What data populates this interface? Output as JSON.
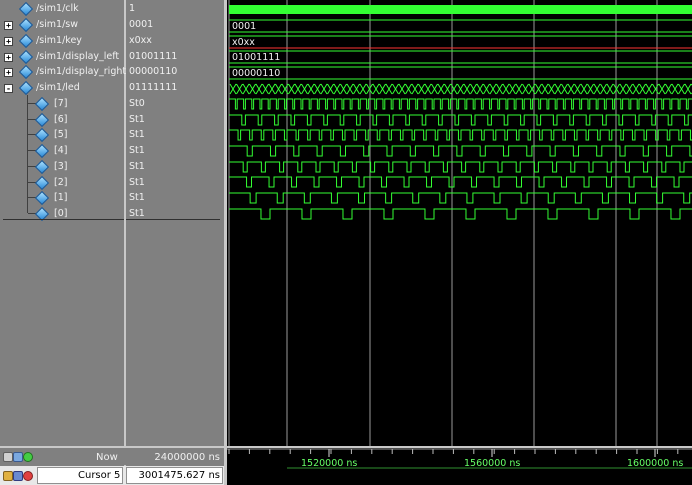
{
  "signals": [
    {
      "name": "/sim1/clk",
      "value": "1",
      "expander": "",
      "level": 0
    },
    {
      "name": "/sim1/sw",
      "value": "0001",
      "expander": "+",
      "level": 0
    },
    {
      "name": "/sim1/key",
      "value": "x0xx",
      "expander": "+",
      "level": 0
    },
    {
      "name": "/sim1/display_left",
      "value": "01001111",
      "expander": "+",
      "level": 0
    },
    {
      "name": "/sim1/display_right",
      "value": "00000110",
      "expander": "+",
      "level": 0
    },
    {
      "name": "/sim1/led",
      "value": "01111111",
      "expander": "-",
      "level": 0
    },
    {
      "name": "[7]",
      "value": "St0",
      "expander": "",
      "level": 1
    },
    {
      "name": "[6]",
      "value": "St1",
      "expander": "",
      "level": 1
    },
    {
      "name": "[5]",
      "value": "St1",
      "expander": "",
      "level": 1
    },
    {
      "name": "[4]",
      "value": "St1",
      "expander": "",
      "level": 1
    },
    {
      "name": "[3]",
      "value": "St1",
      "expander": "",
      "level": 1
    },
    {
      "name": "[2]",
      "value": "St1",
      "expander": "",
      "level": 1
    },
    {
      "name": "[1]",
      "value": "St1",
      "expander": "",
      "level": 1
    },
    {
      "name": "[0]",
      "value": "St1",
      "expander": "",
      "level": 1
    }
  ],
  "waves": {
    "sw_bus": "0001",
    "key_bus": "x0xx",
    "display_left_bus": "01001111",
    "display_right_bus": "00000110"
  },
  "status": {
    "now_label": "Now",
    "now_value": "24000000 ns",
    "cursor_label": "Cursor 5",
    "cursor_value": "3001475.627 ns"
  },
  "timeline": {
    "labels": [
      "1520000 ns",
      "1560000 ns",
      "1600000 ns"
    ]
  },
  "colors": {
    "wave": "#33ff33",
    "bus_red": "#ff3333",
    "background": "#000000"
  },
  "icons": [
    "zoom-icon",
    "add-icon",
    "lock-icon",
    "edit-icon",
    "delete-icon"
  ]
}
